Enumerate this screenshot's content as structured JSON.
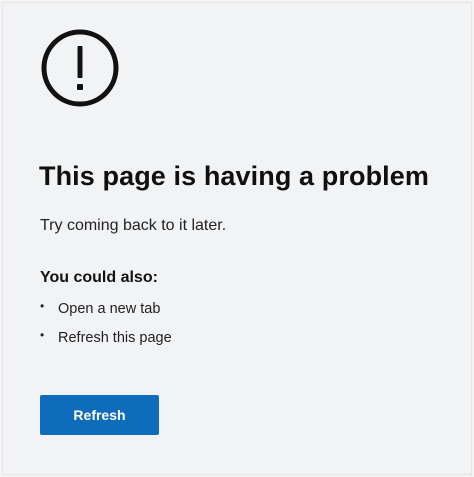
{
  "error": {
    "icon": "exclamation-circle-icon",
    "title": "This page is having a problem",
    "subtitle": "Try coming back to it later."
  },
  "suggestions": {
    "heading": "You could also:",
    "items": [
      {
        "label": "Open a new tab"
      },
      {
        "label": "Refresh this page"
      }
    ]
  },
  "actions": {
    "refresh_label": "Refresh"
  },
  "colors": {
    "background": "#f2f3f5",
    "accent": "#0f6cbd",
    "text": "#111111"
  }
}
